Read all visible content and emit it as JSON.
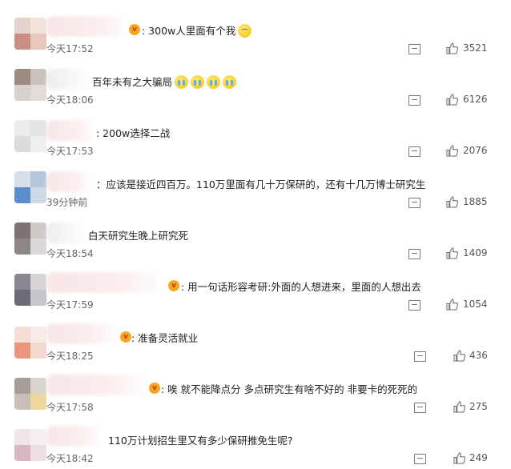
{
  "comments": [
    {
      "text": ": 300w人里面有个我",
      "time": "今天17:52",
      "likes": "3521",
      "emojis": [
        "shy"
      ],
      "badge": true
    },
    {
      "text": "百年未有之大骗局",
      "time": "今天18:06",
      "likes": "6126",
      "emojis": [
        "cry",
        "cry",
        "cry",
        "cry"
      ],
      "badge": false
    },
    {
      "text": ": 200w选择二战",
      "time": "今天17:53",
      "likes": "2076",
      "emojis": [],
      "badge": false
    },
    {
      "text": "：应该是接近四百万。110万里面有几十万保研的，还有十几万博士研究生",
      "time": "39分钟前",
      "likes": "1885",
      "emojis": [],
      "badge": false
    },
    {
      "text": "白天研究生晚上研究死",
      "time": "今天18:54",
      "likes": "1409",
      "emojis": [],
      "badge": false
    },
    {
      "text": ": 用一句话形容考研:外面的人想进来，里面的人想出去",
      "time": "今天17:59",
      "likes": "1054",
      "emojis": [],
      "badge": true
    },
    {
      "text": ": 准备灵活就业",
      "time": "今天18:25",
      "likes": "436",
      "emojis": [],
      "badge": true
    },
    {
      "text": ": 唉 就不能降点分 多点研究生有啥不好的 非要卡的死死的",
      "time": "今天17:58",
      "likes": "275",
      "emojis": [],
      "badge": true
    },
    {
      "text": "110万计划招生里又有多少保研推免生呢?",
      "time": "今天18:42",
      "likes": "249",
      "emojis": [],
      "badge": false
    }
  ],
  "icons": {
    "comment": "comment-icon",
    "like": "like-icon",
    "badge": "vip-badge-icon"
  }
}
